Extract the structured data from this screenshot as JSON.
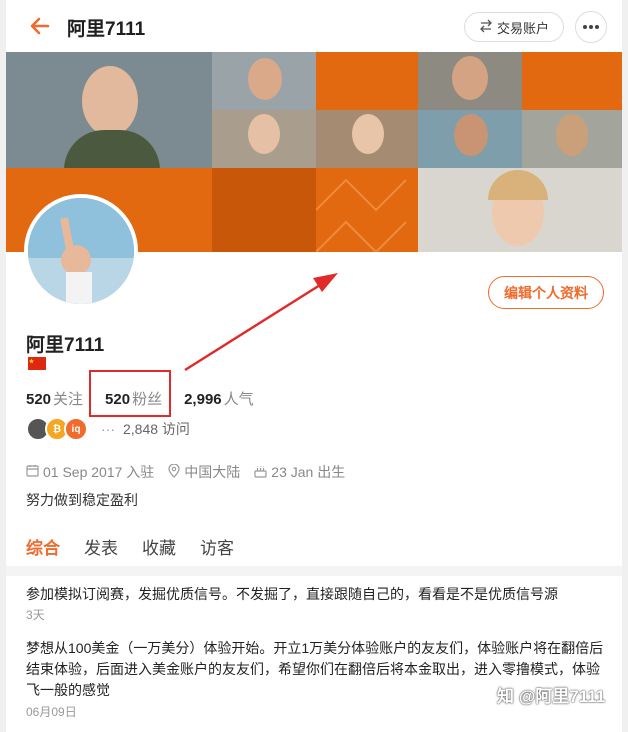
{
  "header": {
    "title": "阿里7111",
    "trade_label": "交易账户"
  },
  "profile": {
    "name": "阿里7111",
    "edit_label": "编辑个人资料",
    "stats": [
      {
        "num": "520",
        "label": "关注"
      },
      {
        "num": "520",
        "label": "粉丝"
      },
      {
        "num": "2,996",
        "label": "人气"
      }
    ],
    "badges": [
      "",
      "₿",
      "iq"
    ],
    "badge_more": "···",
    "visits": "2,848 访问",
    "joined": "01 Sep 2017 入驻",
    "location": "中国大陆",
    "birthday": "23 Jan 出生",
    "bio": "努力做到稳定盈利"
  },
  "tabs": [
    "综合",
    "发表",
    "收藏",
    "访客"
  ],
  "posts": [
    {
      "text": "参加模拟订阅赛，发掘优质信号。不发掘了，直接跟随自己的，看看是不是优质信号源",
      "time": "3天"
    },
    {
      "text": "梦想从100美金（一万美分）体验开始。开立1万美分体验账户的友友们，体验账户将在翻倍后结束体验，后面进入美金账户的友友们，希望你们在翻倍后将本金取出，进入零撸模式，体验飞一般的感觉",
      "time": "06月09日"
    }
  ],
  "watermark": "知 @阿里7111",
  "colors": {
    "accent": "#f06b2c",
    "banner": "#e2690f",
    "highlight": "#e12a2a"
  }
}
